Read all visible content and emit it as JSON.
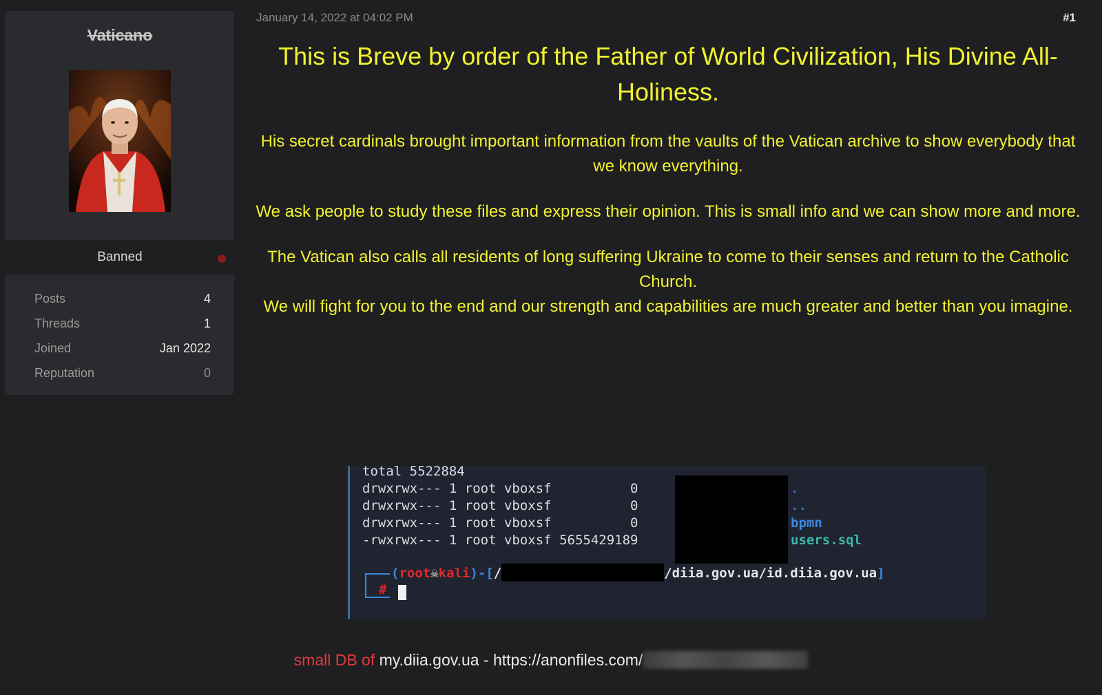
{
  "user": {
    "name": "Vaticano",
    "status": "Banned",
    "stats": [
      {
        "label": "Posts",
        "value": "4"
      },
      {
        "label": "Threads",
        "value": "1"
      },
      {
        "label": "Joined",
        "value": "Jan 2022"
      },
      {
        "label": "Reputation",
        "value": "0"
      }
    ]
  },
  "post": {
    "date": "January 14, 2022 at 04:02 PM",
    "number": "#1",
    "title": "This is Breve by order of the Father of World Civilization, His Divine All-Holiness.",
    "paragraphs": [
      "His secret cardinals brought important information from the vaults of the Vatican archive to show everybody that we know everything.",
      "We ask people to study these files and express their opinion. This is small info and we can show more and more.",
      "The Vatican also calls all residents of long suffering Ukraine to come to their senses and return to the Catholic Church.",
      "We will fight for you to the end and our strength and capabilities are much greater and better than you imagine."
    ]
  },
  "terminal": {
    "total_line": "total 5522884",
    "rows": [
      {
        "perms": "drwxrwx---",
        "links": "1",
        "owner": "root",
        "group": "vboxsf",
        "size": "0",
        "name": "."
      },
      {
        "perms": "drwxrwx---",
        "links": "1",
        "owner": "root",
        "group": "vboxsf",
        "size": "0",
        "name": ".."
      },
      {
        "perms": "drwxrwx---",
        "links": "1",
        "owner": "root",
        "group": "vboxsf",
        "size": "0",
        "name": "bpmn"
      },
      {
        "perms": "-rwxrwx---",
        "links": "1",
        "owner": "root",
        "group": "vboxsf",
        "size": "5655429189",
        "name": "users.sql"
      }
    ],
    "prompt_user": "root",
    "prompt_host": "kali",
    "prompt_path_start": "/",
    "prompt_path_end": "/diia.gov.ua/id.diia.gov.ua",
    "prompt_symbol": "#"
  },
  "footer": {
    "prefix": "small DB of",
    "site": "my.diia.gov.ua",
    "separator": "-",
    "link": "https://anonfiles.com/"
  },
  "colors": {
    "background": "#1f1f21",
    "post_text": "#f2f230",
    "status_dot": "#8b1c1c",
    "footer_red": "#e23b3b"
  }
}
